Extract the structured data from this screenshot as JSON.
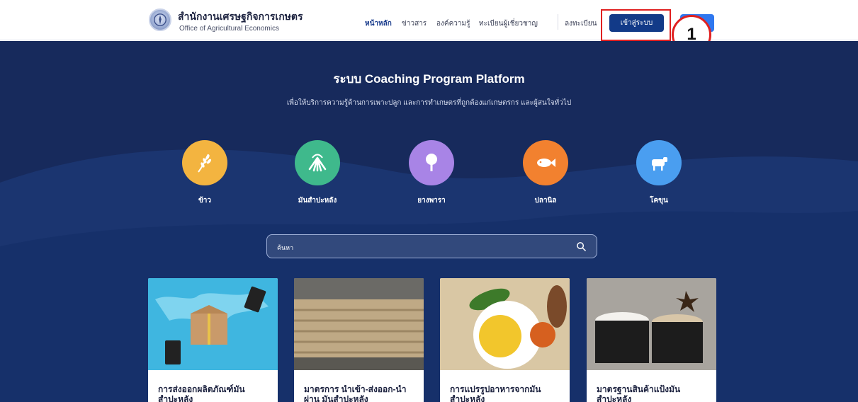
{
  "header": {
    "org_name_th": "สำนักงานเศรษฐกิจการเกษตร",
    "org_name_en": "Office of Agricultural Economics",
    "nav": [
      {
        "label": "หน้าหลัก",
        "active": true
      },
      {
        "label": "ข่าวสาร",
        "active": false
      },
      {
        "label": "องค์ความรู้",
        "active": false
      },
      {
        "label": "ทะเบียนผู้เชี่ยวชาญ",
        "active": false
      }
    ],
    "register_label": "ลงทะเบียน",
    "login_label": "เข้าสู่ระบบ",
    "step_marker": "1"
  },
  "hero": {
    "title": "ระบบ Coaching Program Platform",
    "subtitle": "เพื่อให้บริการความรู้ด้านการเพาะปลูก และการทำเกษตรที่ถูกต้องแก่เกษตรกร และผู้สนใจทั่วไป"
  },
  "categories": [
    {
      "label": "ข้าว",
      "icon": "rice-icon",
      "color": "#f3b440"
    },
    {
      "label": "มันสำปะหลัง",
      "icon": "cassava-icon",
      "color": "#3fb98c"
    },
    {
      "label": "ยางพารา",
      "icon": "rubber-tree-icon",
      "color": "#a884e6"
    },
    {
      "label": "ปลานิล",
      "icon": "fish-icon",
      "color": "#f2812f"
    },
    {
      "label": "โคขุน",
      "icon": "cow-icon",
      "color": "#4a9ef0"
    }
  ],
  "search": {
    "placeholder": "ค้นหา"
  },
  "cards": [
    {
      "title": "การส่งออกผลิตภัณฑ์มัน สำปะหลัง"
    },
    {
      "title": "มาตรการ นำเข้า-ส่งออก-นำ ผ่าน มันสำปะหลัง"
    },
    {
      "title": "การแปรรูปอาหารจากมัน สำปะหลัง"
    },
    {
      "title": "มาตรฐานสินค้าแป้งมัน สำปะหลัง"
    }
  ],
  "colors": {
    "brand_navy": "#123a88",
    "hero_bg": "#172a5c",
    "highlight": "#e02020"
  }
}
